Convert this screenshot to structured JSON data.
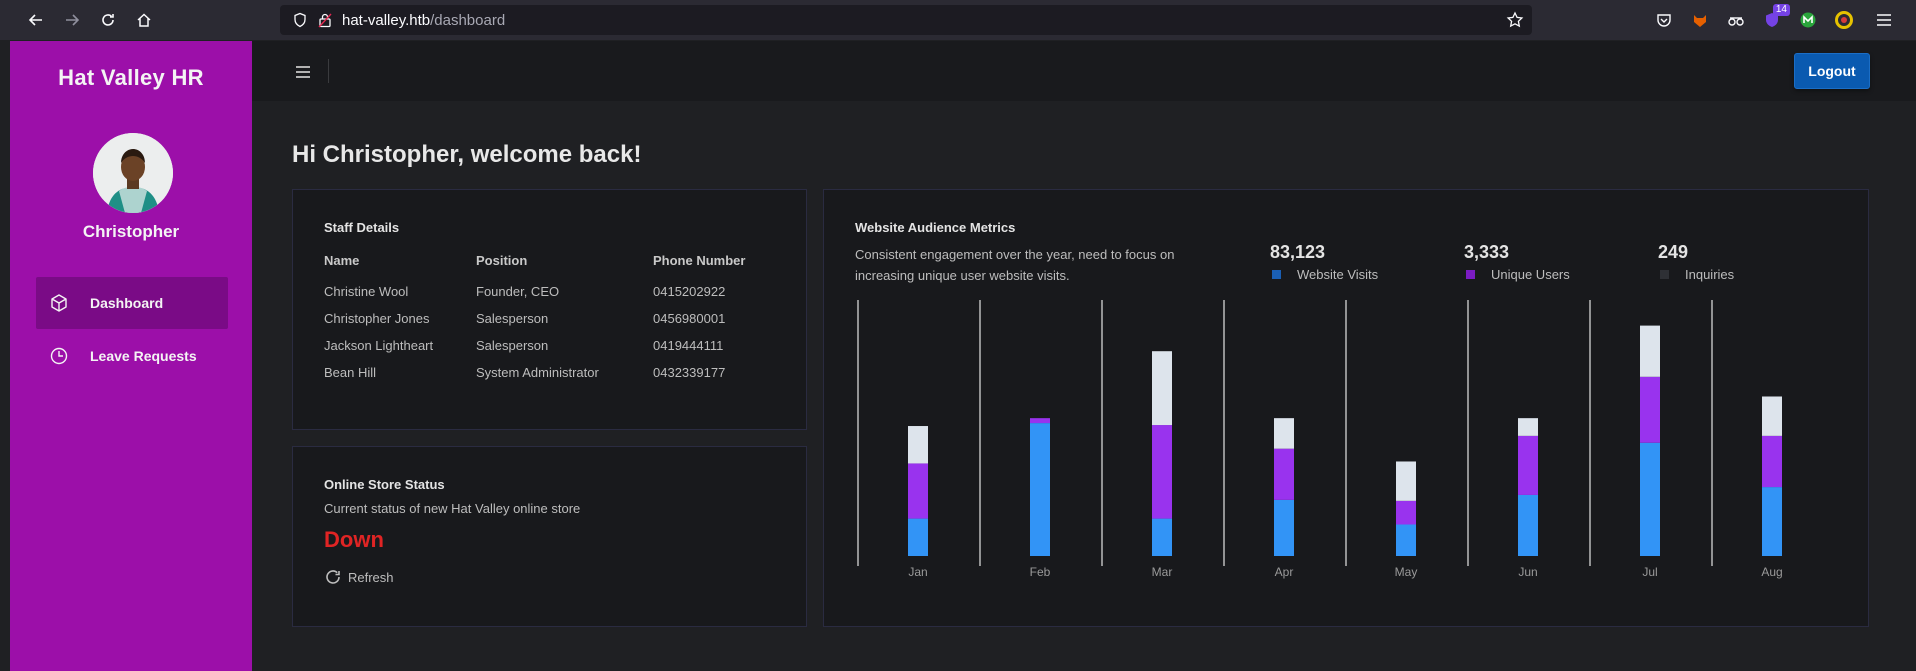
{
  "browser": {
    "url_host": "hat-valley.htb",
    "url_path": "/dashboard",
    "ext_badge": "14"
  },
  "sidebar": {
    "brand": "Hat Valley HR",
    "user_name": "Christopher",
    "items": [
      {
        "label": "Dashboard",
        "icon": "cube-icon"
      },
      {
        "label": "Leave Requests",
        "icon": "clock-icon"
      }
    ]
  },
  "header": {
    "logout_label": "Logout"
  },
  "main": {
    "welcome": "Hi Christopher, welcome back!",
    "staff": {
      "title": "Staff Details",
      "columns": [
        "Name",
        "Position",
        "Phone Number"
      ],
      "rows": [
        [
          "Christine Wool",
          "Founder, CEO",
          "0415202922"
        ],
        [
          "Christopher Jones",
          "Salesperson",
          "0456980001"
        ],
        [
          "Jackson Lightheart",
          "Salesperson",
          "0419444111"
        ],
        [
          "Bean Hill",
          "System Administrator",
          "0432339177"
        ]
      ]
    },
    "store": {
      "title": "Online Store Status",
      "description": "Current status of new Hat Valley online store",
      "status": "Down",
      "refresh_label": "Refresh"
    },
    "metrics": {
      "title": "Website Audience Metrics",
      "description": "Consistent engagement over the year, need to focus on increasing unique user website visits.",
      "stats": [
        {
          "value": "83,123",
          "label": "Website Visits"
        },
        {
          "value": "3,333",
          "label": "Unique Users"
        },
        {
          "value": "249",
          "label": "Inquiries"
        }
      ]
    }
  },
  "colors": {
    "sidebar": "#9c0fa9",
    "visits": "#3294f6",
    "unique": "#9933ee",
    "inquiries": "#dde4ec",
    "status_down": "#e02424",
    "logout": "#0a5ab0"
  },
  "chart_data": {
    "type": "bar",
    "stacked": true,
    "categories": [
      "Jan",
      "Feb",
      "Mar",
      "Apr",
      "May",
      "Jun",
      "Jul",
      "Aug"
    ],
    "series": [
      {
        "name": "Website Visits",
        "color": "#3294f6",
        "values": [
          38,
          135,
          38,
          57,
          32,
          62,
          115,
          70
        ]
      },
      {
        "name": "Unique Users",
        "color": "#9933ee",
        "values": [
          56,
          5,
          95,
          52,
          24,
          60,
          67,
          52
        ]
      },
      {
        "name": "Inquiries",
        "color": "#dde4ec",
        "values": [
          38,
          0,
          75,
          31,
          40,
          18,
          52,
          40
        ]
      }
    ],
    "ylim": [
      0,
      260
    ],
    "grid": "vertical separators",
    "legend": "top"
  }
}
